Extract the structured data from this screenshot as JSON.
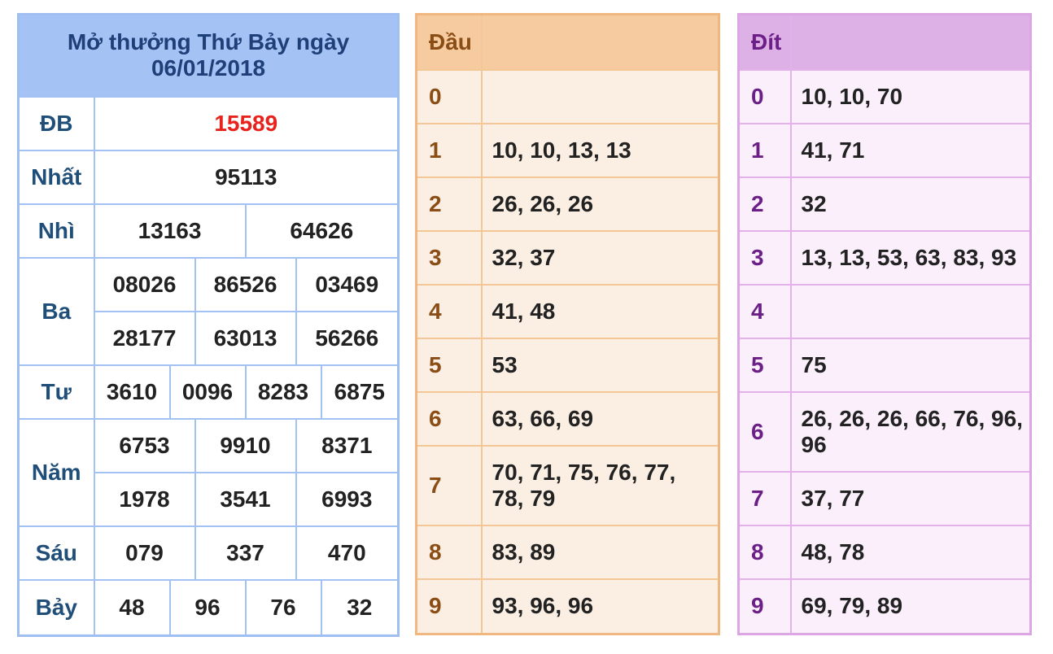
{
  "results": {
    "title_line1": "Mở thưởng Thứ Bảy ngày",
    "title_line2": "06/01/2018",
    "prizes": [
      {
        "label": "ĐB",
        "numbers": [
          "15589"
        ]
      },
      {
        "label": "Nhất",
        "numbers": [
          "95113"
        ]
      },
      {
        "label": "Nhì",
        "numbers": [
          "13163",
          "64626"
        ]
      },
      {
        "label": "Ba",
        "numbers": [
          "08026",
          "86526",
          "03469",
          "28177",
          "63013",
          "56266"
        ]
      },
      {
        "label": "Tư",
        "numbers": [
          "3610",
          "0096",
          "8283",
          "6875"
        ]
      },
      {
        "label": "Năm",
        "numbers": [
          "6753",
          "9910",
          "8371",
          "1978",
          "3541",
          "6993"
        ]
      },
      {
        "label": "Sáu",
        "numbers": [
          "079",
          "337",
          "470"
        ]
      },
      {
        "label": "Bảy",
        "numbers": [
          "48",
          "96",
          "76",
          "32"
        ]
      }
    ]
  },
  "dau": {
    "header": "Đầu",
    "rows": [
      {
        "digit": "0",
        "values": ""
      },
      {
        "digit": "1",
        "values": "10, 10, 13, 13"
      },
      {
        "digit": "2",
        "values": "26, 26, 26"
      },
      {
        "digit": "3",
        "values": "32, 37"
      },
      {
        "digit": "4",
        "values": "41, 48"
      },
      {
        "digit": "5",
        "values": "53"
      },
      {
        "digit": "6",
        "values": "63, 66, 69"
      },
      {
        "digit": "7",
        "values": "70, 71, 75, 76, 77, 78, 79"
      },
      {
        "digit": "8",
        "values": "83, 89"
      },
      {
        "digit": "9",
        "values": "93, 96, 96"
      }
    ]
  },
  "dit": {
    "header": "Đít",
    "rows": [
      {
        "digit": "0",
        "values": "10, 10, 70"
      },
      {
        "digit": "1",
        "values": "41, 71"
      },
      {
        "digit": "2",
        "values": "32"
      },
      {
        "digit": "3",
        "values": "13, 13, 53, 63, 83, 93"
      },
      {
        "digit": "4",
        "values": ""
      },
      {
        "digit": "5",
        "values": "75"
      },
      {
        "digit": "6",
        "values": "26, 26, 26, 66, 76, 96, 96"
      },
      {
        "digit": "7",
        "values": "37, 77"
      },
      {
        "digit": "8",
        "values": "48, 78"
      },
      {
        "digit": "9",
        "values": "69, 79, 89"
      }
    ]
  },
  "colors": {
    "blue_header": "#a4c2f4",
    "special_prize": "#e8231e",
    "orange_header": "#f7cba0",
    "purple_header": "#ddb0e6"
  }
}
